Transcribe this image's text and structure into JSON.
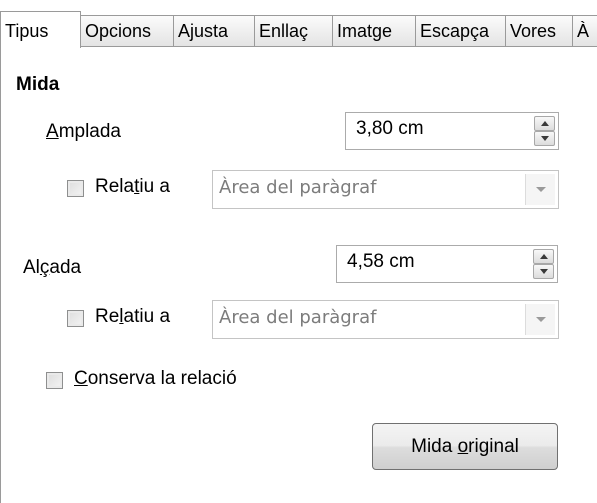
{
  "tabs": [
    {
      "label": "Tipus",
      "active": true
    },
    {
      "label": "Opcions",
      "active": false
    },
    {
      "label": "Ajusta",
      "active": false
    },
    {
      "label": "Enllaç",
      "active": false
    },
    {
      "label": "Imatge",
      "active": false
    },
    {
      "label": "Escapça",
      "active": false
    },
    {
      "label": "Vores",
      "active": false
    },
    {
      "label": "À",
      "active": false
    }
  ],
  "mida": {
    "section_title": "Mida",
    "width": {
      "label_mnemonic": "A",
      "label_rest": "mplada",
      "value": "3,80 cm",
      "relative_checked": false,
      "relative_label_pre": "Rela",
      "relative_label_mnemonic": "t",
      "relative_label_post": "iu a",
      "relative_to": "Àrea del paràgraf"
    },
    "height": {
      "label_pre": "Al",
      "label_mnemonic": "ç",
      "label_post": "ada",
      "value": "4,58 cm",
      "relative_checked": false,
      "relative_label_pre": "Re",
      "relative_label_mnemonic": "l",
      "relative_label_post": "atiu a",
      "relative_to": "Àrea del paràgraf"
    },
    "keep_ratio": {
      "checked": false,
      "label_mnemonic": "C",
      "label_rest": "onserva la relació"
    },
    "original_size_button": {
      "label_pre": "Mida ",
      "label_mnemonic": "o",
      "label_post": "riginal"
    }
  }
}
